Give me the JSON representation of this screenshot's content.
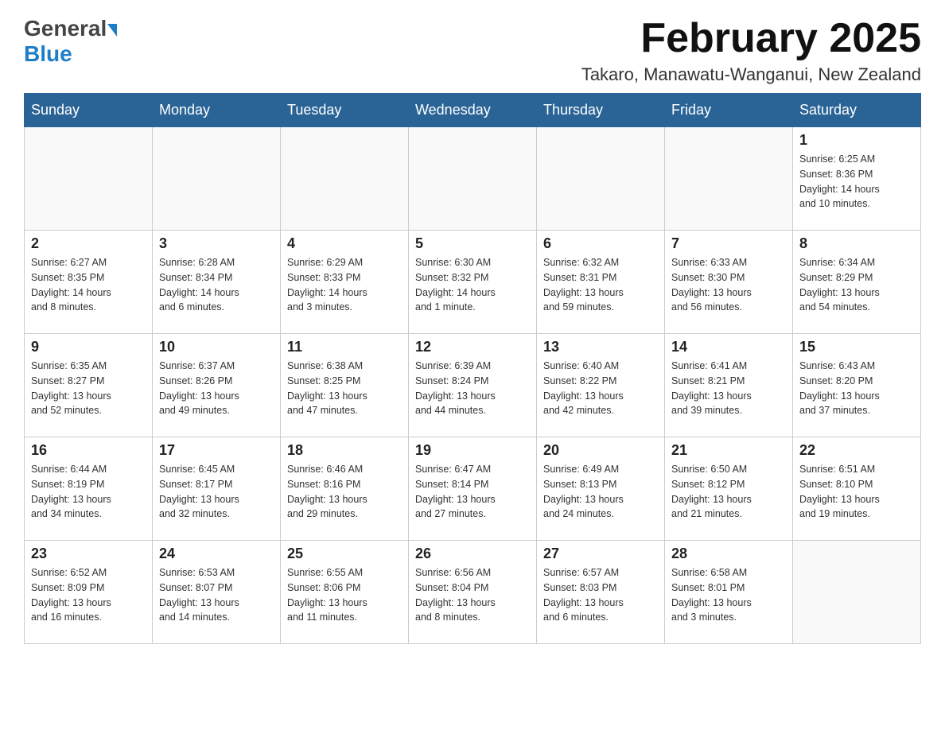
{
  "header": {
    "logo_general": "General",
    "logo_blue": "Blue",
    "month_title": "February 2025",
    "location": "Takaro, Manawatu-Wanganui, New Zealand"
  },
  "days_of_week": [
    "Sunday",
    "Monday",
    "Tuesday",
    "Wednesday",
    "Thursday",
    "Friday",
    "Saturday"
  ],
  "weeks": [
    {
      "days": [
        {
          "date": "",
          "info": ""
        },
        {
          "date": "",
          "info": ""
        },
        {
          "date": "",
          "info": ""
        },
        {
          "date": "",
          "info": ""
        },
        {
          "date": "",
          "info": ""
        },
        {
          "date": "",
          "info": ""
        },
        {
          "date": "1",
          "info": "Sunrise: 6:25 AM\nSunset: 8:36 PM\nDaylight: 14 hours\nand 10 minutes."
        }
      ]
    },
    {
      "days": [
        {
          "date": "2",
          "info": "Sunrise: 6:27 AM\nSunset: 8:35 PM\nDaylight: 14 hours\nand 8 minutes."
        },
        {
          "date": "3",
          "info": "Sunrise: 6:28 AM\nSunset: 8:34 PM\nDaylight: 14 hours\nand 6 minutes."
        },
        {
          "date": "4",
          "info": "Sunrise: 6:29 AM\nSunset: 8:33 PM\nDaylight: 14 hours\nand 3 minutes."
        },
        {
          "date": "5",
          "info": "Sunrise: 6:30 AM\nSunset: 8:32 PM\nDaylight: 14 hours\nand 1 minute."
        },
        {
          "date": "6",
          "info": "Sunrise: 6:32 AM\nSunset: 8:31 PM\nDaylight: 13 hours\nand 59 minutes."
        },
        {
          "date": "7",
          "info": "Sunrise: 6:33 AM\nSunset: 8:30 PM\nDaylight: 13 hours\nand 56 minutes."
        },
        {
          "date": "8",
          "info": "Sunrise: 6:34 AM\nSunset: 8:29 PM\nDaylight: 13 hours\nand 54 minutes."
        }
      ]
    },
    {
      "days": [
        {
          "date": "9",
          "info": "Sunrise: 6:35 AM\nSunset: 8:27 PM\nDaylight: 13 hours\nand 52 minutes."
        },
        {
          "date": "10",
          "info": "Sunrise: 6:37 AM\nSunset: 8:26 PM\nDaylight: 13 hours\nand 49 minutes."
        },
        {
          "date": "11",
          "info": "Sunrise: 6:38 AM\nSunset: 8:25 PM\nDaylight: 13 hours\nand 47 minutes."
        },
        {
          "date": "12",
          "info": "Sunrise: 6:39 AM\nSunset: 8:24 PM\nDaylight: 13 hours\nand 44 minutes."
        },
        {
          "date": "13",
          "info": "Sunrise: 6:40 AM\nSunset: 8:22 PM\nDaylight: 13 hours\nand 42 minutes."
        },
        {
          "date": "14",
          "info": "Sunrise: 6:41 AM\nSunset: 8:21 PM\nDaylight: 13 hours\nand 39 minutes."
        },
        {
          "date": "15",
          "info": "Sunrise: 6:43 AM\nSunset: 8:20 PM\nDaylight: 13 hours\nand 37 minutes."
        }
      ]
    },
    {
      "days": [
        {
          "date": "16",
          "info": "Sunrise: 6:44 AM\nSunset: 8:19 PM\nDaylight: 13 hours\nand 34 minutes."
        },
        {
          "date": "17",
          "info": "Sunrise: 6:45 AM\nSunset: 8:17 PM\nDaylight: 13 hours\nand 32 minutes."
        },
        {
          "date": "18",
          "info": "Sunrise: 6:46 AM\nSunset: 8:16 PM\nDaylight: 13 hours\nand 29 minutes."
        },
        {
          "date": "19",
          "info": "Sunrise: 6:47 AM\nSunset: 8:14 PM\nDaylight: 13 hours\nand 27 minutes."
        },
        {
          "date": "20",
          "info": "Sunrise: 6:49 AM\nSunset: 8:13 PM\nDaylight: 13 hours\nand 24 minutes."
        },
        {
          "date": "21",
          "info": "Sunrise: 6:50 AM\nSunset: 8:12 PM\nDaylight: 13 hours\nand 21 minutes."
        },
        {
          "date": "22",
          "info": "Sunrise: 6:51 AM\nSunset: 8:10 PM\nDaylight: 13 hours\nand 19 minutes."
        }
      ]
    },
    {
      "days": [
        {
          "date": "23",
          "info": "Sunrise: 6:52 AM\nSunset: 8:09 PM\nDaylight: 13 hours\nand 16 minutes."
        },
        {
          "date": "24",
          "info": "Sunrise: 6:53 AM\nSunset: 8:07 PM\nDaylight: 13 hours\nand 14 minutes."
        },
        {
          "date": "25",
          "info": "Sunrise: 6:55 AM\nSunset: 8:06 PM\nDaylight: 13 hours\nand 11 minutes."
        },
        {
          "date": "26",
          "info": "Sunrise: 6:56 AM\nSunset: 8:04 PM\nDaylight: 13 hours\nand 8 minutes."
        },
        {
          "date": "27",
          "info": "Sunrise: 6:57 AM\nSunset: 8:03 PM\nDaylight: 13 hours\nand 6 minutes."
        },
        {
          "date": "28",
          "info": "Sunrise: 6:58 AM\nSunset: 8:01 PM\nDaylight: 13 hours\nand 3 minutes."
        },
        {
          "date": "",
          "info": ""
        }
      ]
    }
  ]
}
